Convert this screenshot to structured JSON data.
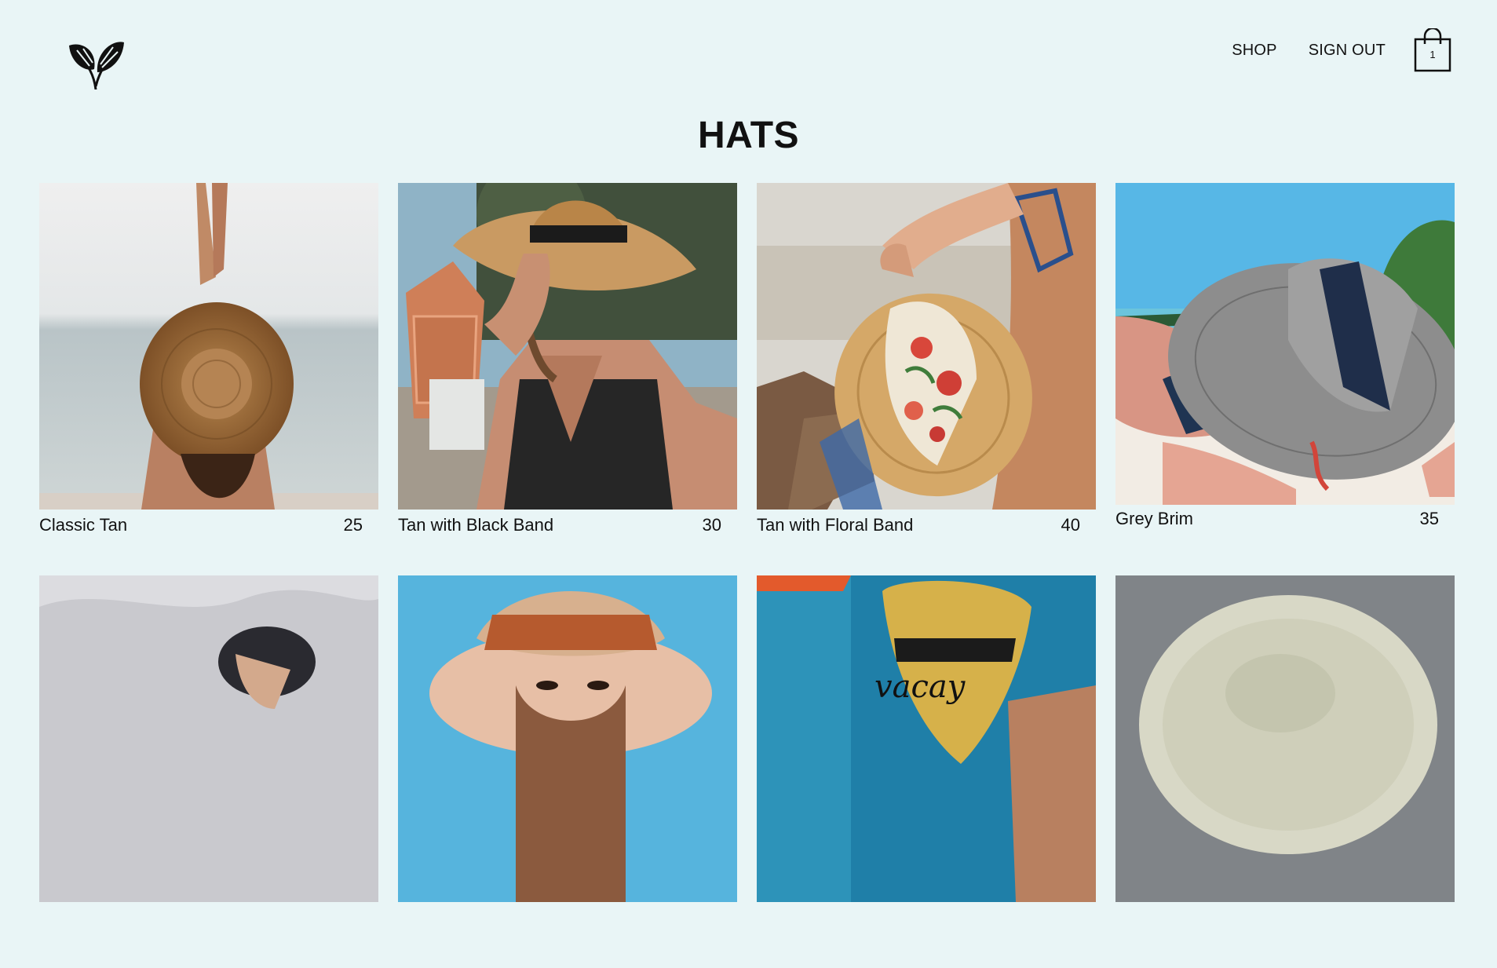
{
  "brand": {
    "logo_icon": "leaf-logo-icon"
  },
  "nav": {
    "shop_label": "SHOP",
    "sign_out_label": "SIGN OUT",
    "cart_count": "1",
    "cart_icon": "shopping-bag-icon"
  },
  "page": {
    "title": "HATS"
  },
  "products": [
    {
      "name": "Classic Tan",
      "price": "25"
    },
    {
      "name": "Tan with Black Band",
      "price": "30"
    },
    {
      "name": "Tan with Floral Band",
      "price": "40"
    },
    {
      "name": "Grey Brim",
      "price": "35"
    },
    {
      "name": "",
      "price": ""
    },
    {
      "name": "",
      "price": ""
    },
    {
      "name": "",
      "price": ""
    },
    {
      "name": "",
      "price": ""
    }
  ],
  "colors": {
    "background": "#e9f5f6",
    "text": "#111111"
  }
}
